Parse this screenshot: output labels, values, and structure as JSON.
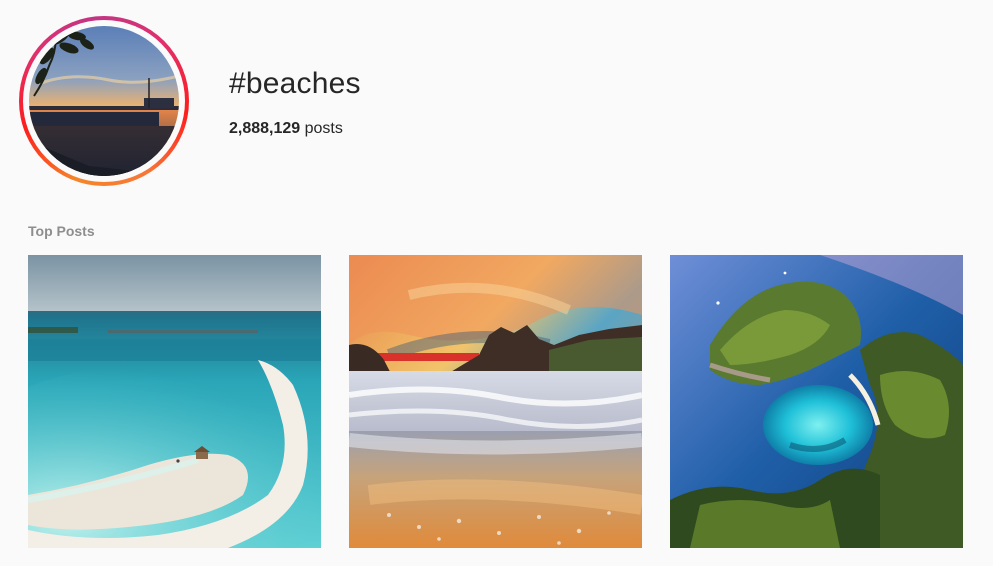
{
  "hashtag": {
    "title": "#beaches",
    "post_count": "2,888,129",
    "post_count_suffix": " posts"
  },
  "sections": {
    "top_posts_label": "Top Posts"
  },
  "top_posts": [
    {
      "image": "aerial-sandbar-lagoon"
    },
    {
      "image": "sunset-rocky-beach-long-exposure"
    },
    {
      "image": "aerial-tropical-island-cove"
    }
  ],
  "colors": {
    "background": "#fafafa",
    "text": "#262626",
    "muted": "#8e8e8e",
    "story_ring": [
      "#f58529",
      "#fd1d1d",
      "#e1306c",
      "#c13584"
    ]
  }
}
